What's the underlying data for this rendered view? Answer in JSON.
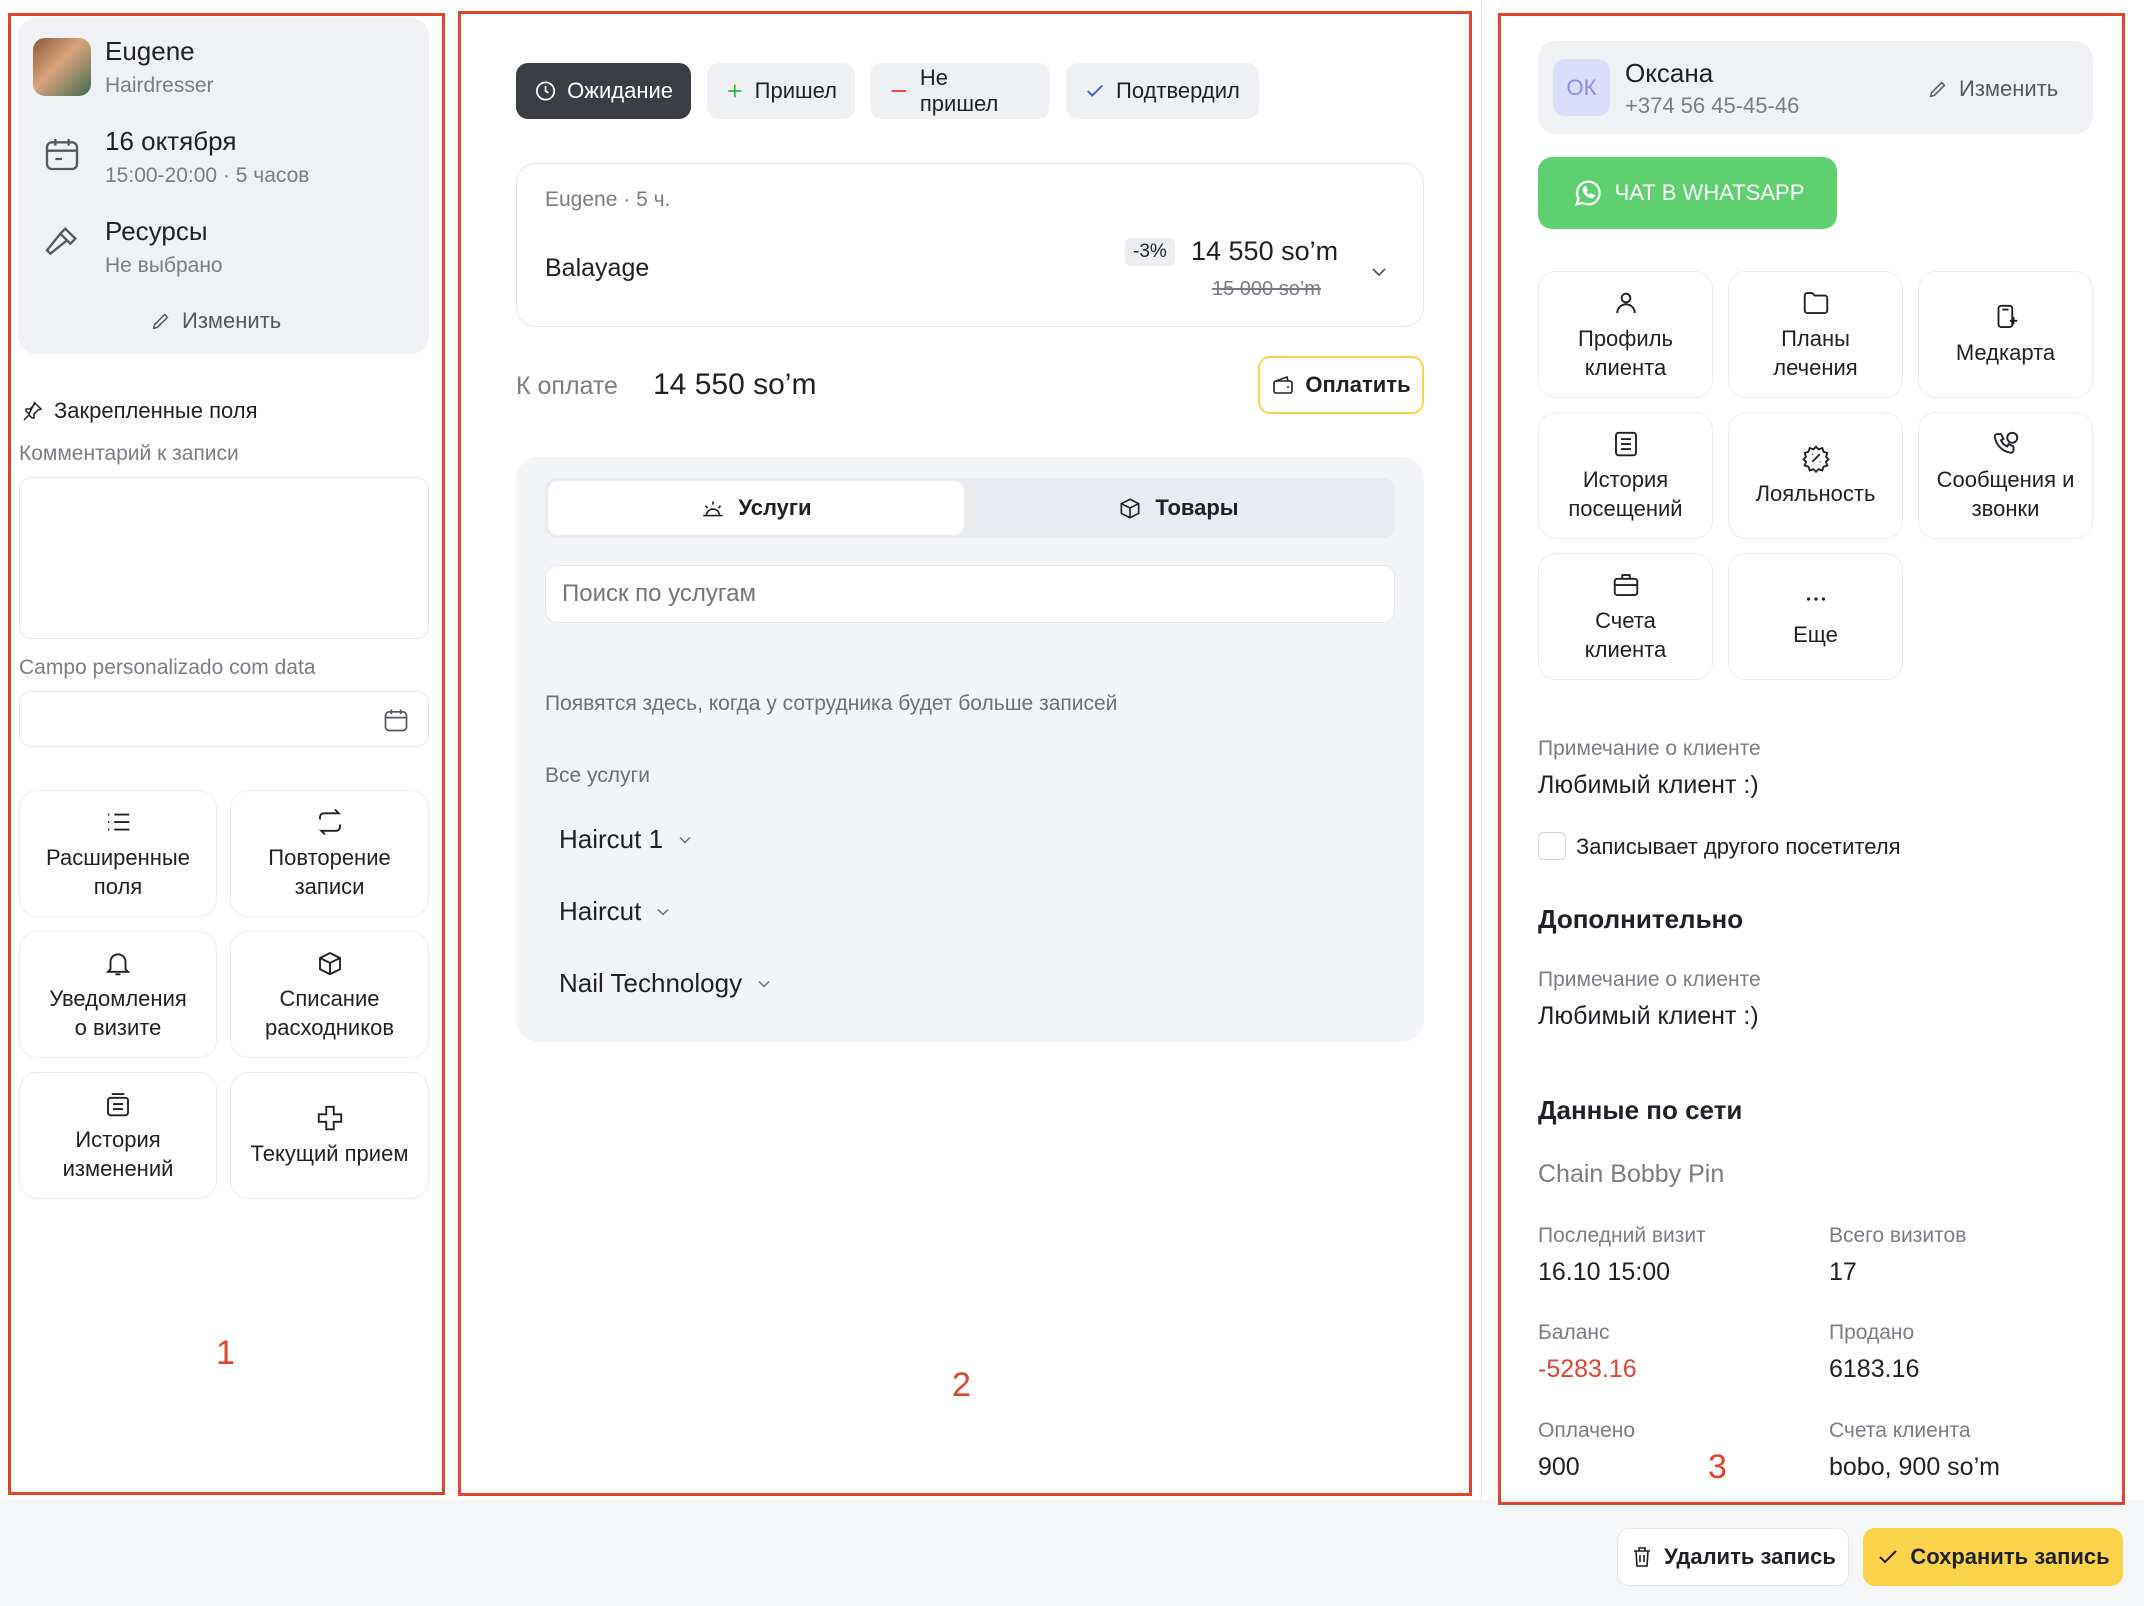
{
  "left": {
    "employee": {
      "name": "Eugene",
      "role": "Hairdresser"
    },
    "date": {
      "title": "16 октября",
      "time": "15:00-20:00 · 5 часов"
    },
    "resources": {
      "title": "Ресурсы",
      "value": "Не выбрано"
    },
    "edit_label": "Изменить",
    "pinned_title": "Закрепленные поля",
    "comment_label": "Комментарий к записи",
    "comment_value": "",
    "custom_date_label": "Campo personalizado com data",
    "custom_date_value": "",
    "tiles": [
      {
        "label": "Расширенные\nполя",
        "icon": "list-icon"
      },
      {
        "label": "Повторение\nзаписи",
        "icon": "repeat-icon"
      },
      {
        "label": "Уведомления\nо визите",
        "icon": "bell-icon"
      },
      {
        "label": "Списание\nрасходников",
        "icon": "box-icon"
      },
      {
        "label": "История\nизменений",
        "icon": "history-icon"
      },
      {
        "label": "Текущий прием",
        "icon": "plus-cross-icon"
      }
    ]
  },
  "middle": {
    "statuses": [
      {
        "label": "Ожидание",
        "icon": "clock-icon",
        "active": true
      },
      {
        "label": "Пришел",
        "icon": "plus-icon",
        "active": false
      },
      {
        "label": "Не пришел",
        "icon": "minus-icon",
        "active": false
      },
      {
        "label": "Подтвердил",
        "icon": "check-icon",
        "active": false
      }
    ],
    "service": {
      "meta": "Eugene · 5 ч.",
      "name": "Balayage",
      "discount": "-3%",
      "price": "14 550 so’m",
      "old_price": "15 000 so’m"
    },
    "to_pay_label": "К оплате",
    "to_pay_value": "14 550 so’m",
    "pay_button": "Оплатить",
    "tabs": {
      "services": "Услуги",
      "goods": "Товары"
    },
    "search_placeholder": "Поиск по услугам",
    "empty_hint": "Появятся здесь, когда у сотрудника будет больше записей",
    "all_services_label": "Все услуги",
    "categories": [
      "Haircut 1",
      "Haircut",
      "Nail Technology"
    ]
  },
  "right": {
    "client": {
      "initials": "ОК",
      "name": "Оксана",
      "phone": "+374 56 45-45-46",
      "edit": "Изменить"
    },
    "whatsapp_button": "ЧАТ В WHATSAPP",
    "tiles": [
      {
        "label": "Профиль\nклиента",
        "icon": "user-icon"
      },
      {
        "label": "Планы\nлечения",
        "icon": "folder-icon"
      },
      {
        "label": "Медкарта",
        "icon": "medcard-icon"
      },
      {
        "label": "История\nпосещений",
        "icon": "document-list-icon"
      },
      {
        "label": "Лояльность",
        "icon": "percent-badge-icon"
      },
      {
        "label": "Сообщения и\nзвонки",
        "icon": "phone-chat-icon"
      },
      {
        "label": "Счета\nклиента",
        "icon": "briefcase-icon"
      },
      {
        "label": "Еще",
        "icon": "more-dots-icon"
      }
    ],
    "note_label": "Примечание о клиенте",
    "note_value": "Любимый клиент :)",
    "other_visitor_label": "Записывает другого посетителя",
    "additional_title": "Дополнительно",
    "additional_note_label": "Примечание о клиенте",
    "additional_note_value": "Любимый клиент :)",
    "network_title": "Данные по сети",
    "chain_name": "Chain Bobby Pin",
    "stats": {
      "last_visit_label": "Последний визит",
      "last_visit_value": "16.10 15:00",
      "total_visits_label": "Всего визитов",
      "total_visits_value": "17",
      "balance_label": "Баланс",
      "balance_value": "-5283.16",
      "sold_label": "Продано",
      "sold_value": "6183.16",
      "paid_label": "Оплачено",
      "paid_value": "900",
      "accounts_label": "Счета клиента",
      "accounts_value": "bobo, 900 so’m"
    }
  },
  "footer": {
    "delete": "Удалить запись",
    "save": "Сохранить запись"
  },
  "callouts": [
    "1",
    "2",
    "3"
  ],
  "colors": {
    "accent_yellow": "#fad34a",
    "whatsapp_green": "#5fd06f",
    "danger_red": "#e0453a",
    "annotation_red": "#e0452f"
  }
}
